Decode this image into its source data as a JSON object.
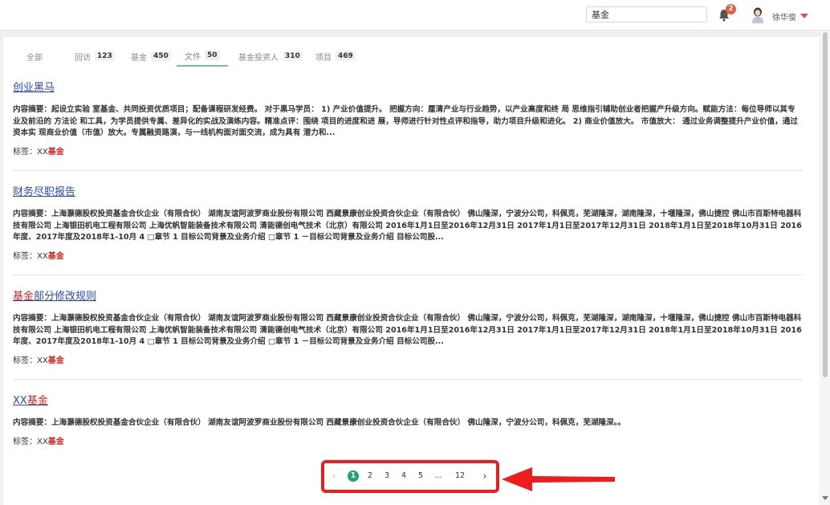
{
  "header": {
    "search_value": "基金",
    "notification_count": "2",
    "username": "徐华俊"
  },
  "tabs": [
    {
      "label": "全部",
      "count": ""
    },
    {
      "label": "回访",
      "count": "123"
    },
    {
      "label": "基金",
      "count": "450"
    },
    {
      "label": "文件",
      "count": "50"
    },
    {
      "label": "基金投资人",
      "count": "310"
    },
    {
      "label": "项目",
      "count": "469"
    }
  ],
  "active_tab": "文件",
  "results": [
    {
      "title_pre": "创业黑马",
      "title_hl": "",
      "title_post": "",
      "summary": "内容摘要：起设立实验 室基金、共同投资优质项目；配备课程研发经费。 对于黑马学员： 1) 产业价值提升。 把握方向：厘清产业与行业趋势，以产业高度和终 局 思维指引辅助创业者把握产升级方向。赋能方法：每位导师以其专业及前沿的 方法论 和工具，为学员提供专属、差异化的实战及演练内容。精准点评：围绕 项目的进度和进 展，导师进行针对性点评和指导，助力项目升级和进化。 2) 商业价值放大。 市值放大： 通过业务调整提升产业价值，通过资本实 现商业价值（市值）放大。专属融资路演，与一线机构面对面交流，成为具有 潜力和...",
      "tag_prefix": "标签：XX",
      "tag_hl": "基金"
    },
    {
      "title_pre": "财务尽职报告",
      "title_hl": "",
      "title_post": "",
      "summary": "内容摘要：上海灏德股权投资基金合伙企业（有限合伙） 湖南友谊阿波罗商业股份有限公司 西藏景康创业投资合伙企业（有限合伙） 佛山隆深，宁波分公司，科佩克，芜湖隆深，湖南隆深，十堰隆深，佛山捷控 佛山市百斯特电器科技有限公司 上海银田机电工程有限公司 上海优帆智能装备技术有限公司 清能德创电气技术（北京）有限公司 2016年1月1日至2016年12月31日 2017年1月1日至2017年12月31日 2018年1月1日至2018年10月31日 2016年度、2017年度及2018年1-10月 4 □章节 1 目标公司背景及业务介绍 □章节 1 －目标公司背景及业务介绍 目标公司股...",
      "tag_prefix": "标签：XX",
      "tag_hl": "基金"
    },
    {
      "title_pre": "",
      "title_hl": "基金",
      "title_post": "部分修改规则",
      "summary": "内容摘要：上海灏德股权投资基金合伙企业（有限合伙） 湖南友谊阿波罗商业股份有限公司 西藏景康创业投资合伙企业（有限合伙） 佛山隆深，宁波分公司，科佩克，芜湖隆深，湖南隆深，十堰隆深，佛山捷控 佛山市百斯特电器科技有限公司 上海银田机电工程有限公司 上海优帆智能装备技术有限公司 清能德创电气技术（北京）有限公司 2016年1月1日至2016年12月31日 2017年1月1日至2017年12月31日 2018年1月1日至2018年10月31日 2016年度、2017年度及2018年1-10月 4 □章节 1 目标公司背景及业务介绍 □章节 1 －目标公司背景及业务介绍 目标公司股...",
      "tag_prefix": "标签：XX",
      "tag_hl": "基金"
    },
    {
      "title_pre": "XX",
      "title_hl": "基金",
      "title_post": "",
      "summary": "内容摘要：上海灏德股权投资基金合伙企业（有限合伙） 湖南友谊阿波罗商业股份有限公司 西藏景康创业投资合伙企业（有限合伙） 佛山隆深，宁波分公司，科佩克，芜湖隆深。。",
      "tag_prefix": "标签：XX",
      "tag_hl": "基金"
    }
  ],
  "pagination": {
    "prev": "‹",
    "next": "›",
    "pages": [
      "1",
      "2",
      "3",
      "4",
      "5",
      "...",
      "12"
    ],
    "current": "1"
  },
  "colors": {
    "accent": "#1aa57a",
    "highlight": "#e02424",
    "link": "#2a45c9",
    "annotation": "#ee1c1c"
  }
}
